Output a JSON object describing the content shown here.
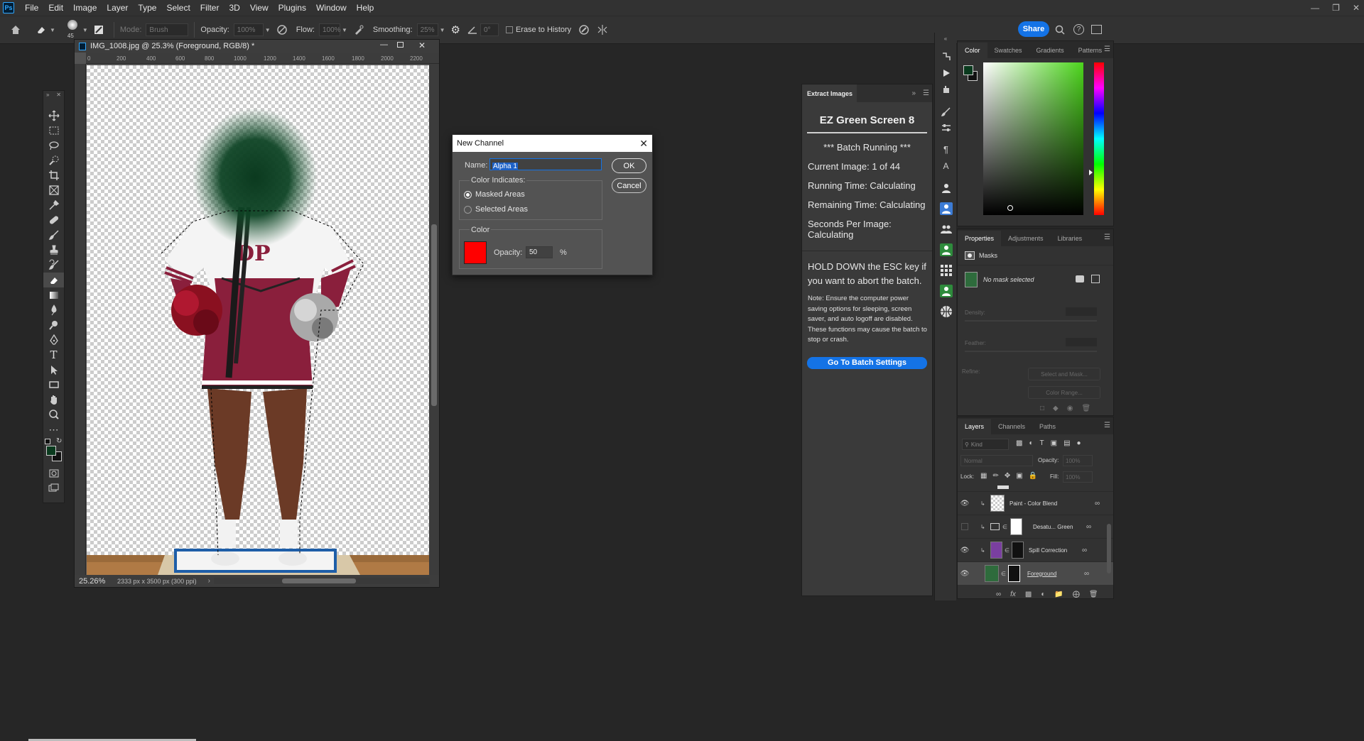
{
  "menubar": {
    "logo": "Ps",
    "items": [
      "File",
      "Edit",
      "Image",
      "Layer",
      "Type",
      "Select",
      "Filter",
      "3D",
      "View",
      "Plugins",
      "Window",
      "Help"
    ]
  },
  "options": {
    "brush_size": "45",
    "mode_label": "Mode:",
    "mode_value": "Brush",
    "opacity_label": "Opacity:",
    "opacity_value": "100%",
    "flow_label": "Flow:",
    "flow_value": "100%",
    "smoothing_label": "Smoothing:",
    "smoothing_value": "25%",
    "angle_value": "0°",
    "erase_history_label": "Erase to History",
    "share_label": "Share"
  },
  "document": {
    "title": "IMG_1008.jpg @ 25.3% (Foreground, RGB/8) *",
    "ruler_ticks": [
      "0",
      "200",
      "400",
      "600",
      "800",
      "1000",
      "1200",
      "1400",
      "1600",
      "1800",
      "2000",
      "2200"
    ],
    "zoom": "25.26%",
    "info": "2333 px x 3500 px (300 ppi)",
    "shirt_letters": "DP"
  },
  "dialog": {
    "title": "New Channel",
    "name_label": "Name:",
    "name_value": "Alpha 1",
    "ok_label": "OK",
    "cancel_label": "Cancel",
    "color_indicates_label": "Color Indicates:",
    "masked_areas_label": "Masked Areas",
    "selected_areas_label": "Selected Areas",
    "color_group_label": "Color",
    "opacity_label": "Opacity:",
    "opacity_value": "50",
    "percent": "%",
    "swatch_color": "#ff0000"
  },
  "extract": {
    "tab": "Extract Images",
    "title": "EZ Green Screen 8",
    "batch_running": "*** Batch Running ***",
    "current_image": "Current Image: 1 of 44",
    "running_time": "Running Time: Calculating",
    "remaining_time": "Remaining Time: Calculating",
    "seconds_per_image": "Seconds Per Image: Calculating",
    "esc_note": "HOLD DOWN the ESC key if you want to abort the batch.",
    "power_note": "Note: Ensure the computer power saving options for sleeping, screen saver, and auto logoff are disabled. These functions may cause the batch to stop or crash.",
    "button": "Go To Batch Settings",
    "accent": "#1473e6"
  },
  "color_panel": {
    "tabs": [
      "Color",
      "Swatches",
      "Gradients",
      "Patterns"
    ],
    "foreground": "#0a3a1e"
  },
  "properties": {
    "tabs": [
      "Properties",
      "Adjustments",
      "Libraries"
    ],
    "masks_label": "Masks",
    "no_mask": "No mask selected",
    "density_label": "Density:",
    "feather_label": "Feather:",
    "refine_label": "Refine:",
    "select_mask_btn": "Select and Mask...",
    "color_range_btn": "Color Range..."
  },
  "layers": {
    "tabs": [
      "Layers",
      "Channels",
      "Paths"
    ],
    "kind_placeholder": "Kind",
    "blend_mode": "Normal",
    "opacity_label": "Opacity:",
    "opacity_value": "100%",
    "lock_label": "Lock:",
    "fill_label": "Fill:",
    "fill_value": "100%",
    "rows": [
      {
        "name": "Paint - Color Blend",
        "visible": true
      },
      {
        "name": "Desatu... Green",
        "visible": false
      },
      {
        "name": "Spill Correction",
        "visible": true
      },
      {
        "name": "Foreground",
        "visible": true
      }
    ]
  }
}
